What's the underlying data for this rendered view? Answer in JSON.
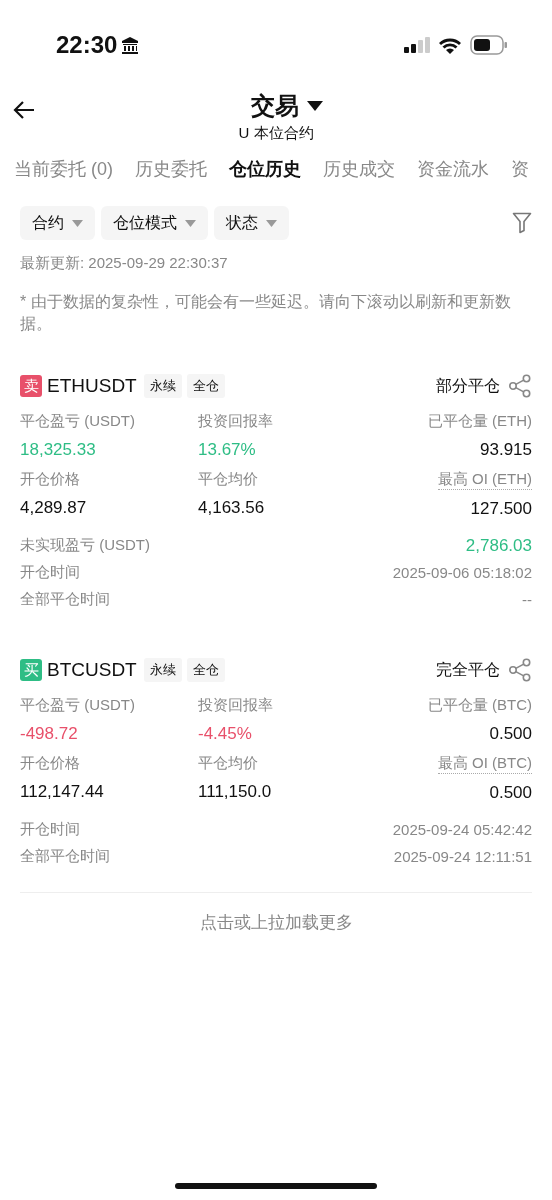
{
  "status_bar": {
    "time": "22:30"
  },
  "header": {
    "title": "交易",
    "subtitle": "U 本位合约"
  },
  "tabs": [
    {
      "label": "当前委托 (0)",
      "selected": false
    },
    {
      "label": "历史委托",
      "selected": false
    },
    {
      "label": "仓位历史",
      "selected": true
    },
    {
      "label": "历史成交",
      "selected": false
    },
    {
      "label": "资金流水",
      "selected": false
    },
    {
      "label": "资",
      "selected": false
    }
  ],
  "filters": [
    {
      "label": "合约"
    },
    {
      "label": "仓位模式"
    },
    {
      "label": "状态"
    }
  ],
  "last_update": "最新更新: 2025-09-29 22:30:37",
  "note": "* 由于数据的复杂性，可能会有一些延迟。请向下滚动以刷新和更新数据。",
  "positions": [
    {
      "side": {
        "label": "卖",
        "color": "#e8506a"
      },
      "symbol": "ETHUSDT",
      "tags": [
        "永续",
        "全仓"
      ],
      "status": "部分平仓",
      "fields": [
        {
          "label": "平仓盈亏 (USDT)",
          "value": "18,325.33",
          "color": "#2ebd85",
          "dotted": false
        },
        {
          "label": "投资回报率",
          "value": "13.67%",
          "color": "#2ebd85",
          "dotted": false
        },
        {
          "label": "已平仓量 (ETH)",
          "value": "93.915",
          "color": "#111111",
          "dotted": false
        },
        {
          "label": "开仓价格",
          "value": "4,289.87",
          "color": "#111111",
          "dotted": false
        },
        {
          "label": "平仓均价",
          "value": "4,163.56",
          "color": "#111111",
          "dotted": false
        },
        {
          "label": "最高 OI (ETH)",
          "value": "127.500",
          "color": "#111111",
          "dotted": true
        }
      ],
      "rows": [
        {
          "label": "未实现盈亏 (USDT)",
          "value": "2,786.03",
          "color": "#2ebd85"
        },
        {
          "label": "开仓时间",
          "value": "2025-09-06 05:18:02",
          "color": "#888888"
        },
        {
          "label": "全部平仓时间",
          "value": "--",
          "color": "#888888"
        }
      ]
    },
    {
      "side": {
        "label": "买",
        "color": "#2ebd85"
      },
      "symbol": "BTCUSDT",
      "tags": [
        "永续",
        "全仓"
      ],
      "status": "完全平仓",
      "fields": [
        {
          "label": "平仓盈亏 (USDT)",
          "value": "-498.72",
          "color": "#e8506a",
          "dotted": false
        },
        {
          "label": "投资回报率",
          "value": "-4.45%",
          "color": "#e8506a",
          "dotted": false
        },
        {
          "label": "已平仓量 (BTC)",
          "value": "0.500",
          "color": "#111111",
          "dotted": false
        },
        {
          "label": "开仓价格",
          "value": "112,147.44",
          "color": "#111111",
          "dotted": false
        },
        {
          "label": "平仓均价",
          "value": "111,150.0",
          "color": "#111111",
          "dotted": false
        },
        {
          "label": "最高 OI (BTC)",
          "value": "0.500",
          "color": "#111111",
          "dotted": true
        }
      ],
      "rows": [
        {
          "label": "开仓时间",
          "value": "2025-09-24 05:42:42",
          "color": "#888888"
        },
        {
          "label": "全部平仓时间",
          "value": "2025-09-24 12:11:51",
          "color": "#888888"
        }
      ]
    }
  ],
  "load_more": "点击或上拉加载更多"
}
